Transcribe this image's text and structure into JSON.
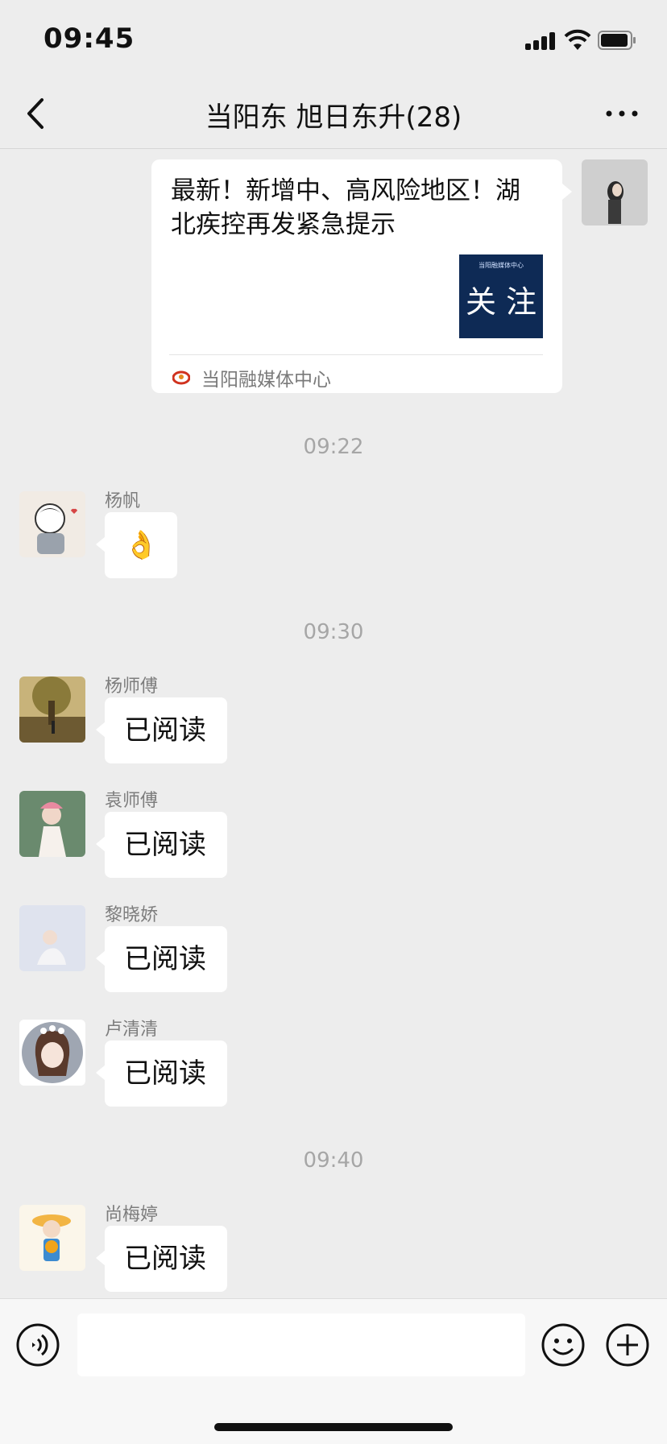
{
  "status_bar": {
    "time": "09:45"
  },
  "header": {
    "title": "当阳东 旭日东升(28)"
  },
  "shared_card": {
    "title": "最新！新增中、高风险地区！湖北疾控再发紧急提示",
    "thumbnail_top": "当阳融媒体中心",
    "thumbnail_text": "关 注",
    "source": "当阳融媒体中心"
  },
  "messages": [
    {
      "time": "09:22"
    },
    {
      "sender": "杨帆",
      "text": "👌"
    },
    {
      "time": "09:30"
    },
    {
      "sender": "杨师傅",
      "text": "已阅读"
    },
    {
      "sender": "袁师傅",
      "text": "已阅读"
    },
    {
      "sender": "黎晓娇",
      "text": "已阅读"
    },
    {
      "sender": "卢清清",
      "text": "已阅读"
    },
    {
      "time": "09:40"
    },
    {
      "sender": "尚梅婷",
      "text": "已阅读"
    }
  ],
  "input_bar": {
    "text": ""
  }
}
